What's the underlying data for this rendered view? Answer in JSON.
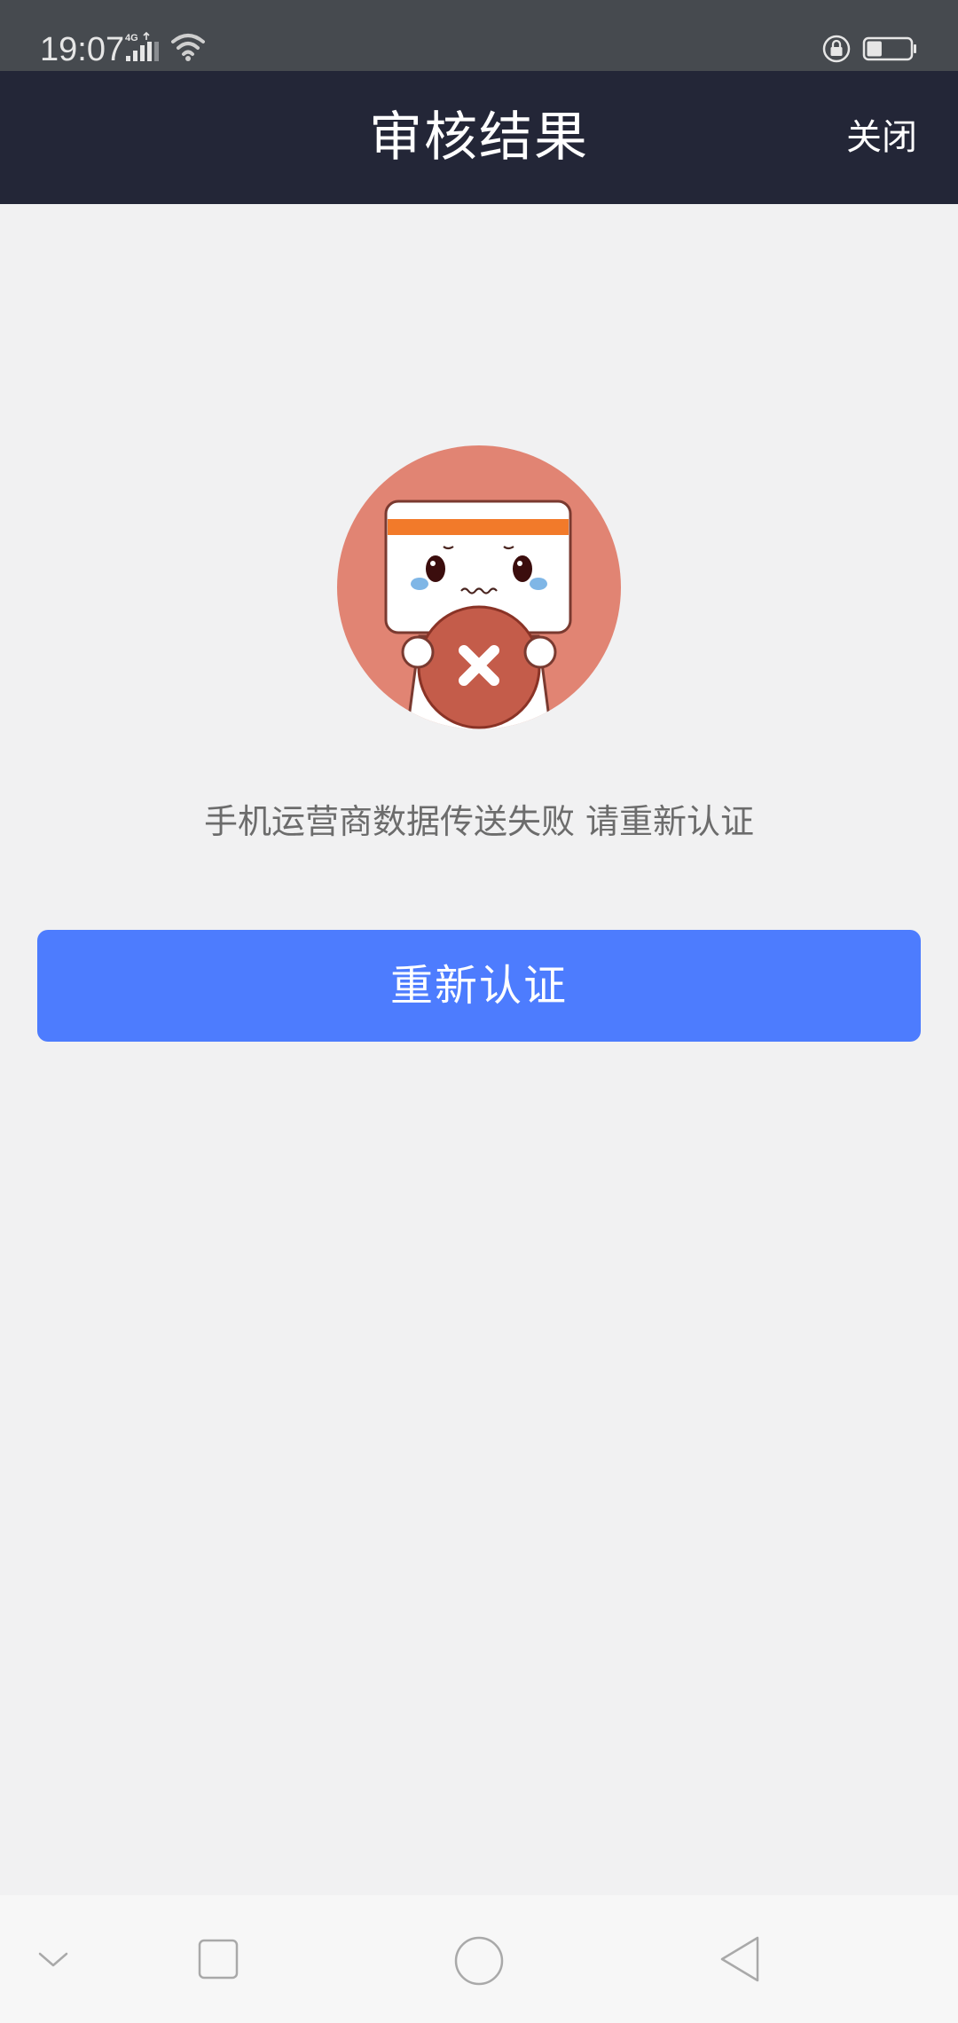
{
  "status_bar": {
    "time": "19:07",
    "network_label": "4G",
    "icons": [
      "signal-4g-icon",
      "wifi-icon",
      "rotation-lock-icon",
      "battery-icon"
    ],
    "battery_level": 0.35
  },
  "header": {
    "title": "审核结果",
    "close_label": "关闭",
    "background_color": "#232637"
  },
  "main": {
    "illustration": "failed-verification-mascot",
    "message": "手机运营商数据传送失败 请重新认证",
    "retry_label": "重新认证",
    "button_color": "#4d7cfe"
  },
  "nav_bar": {
    "icons": [
      "collapse-chevron-icon",
      "recents-square-icon",
      "home-circle-icon",
      "back-triangle-icon"
    ]
  }
}
